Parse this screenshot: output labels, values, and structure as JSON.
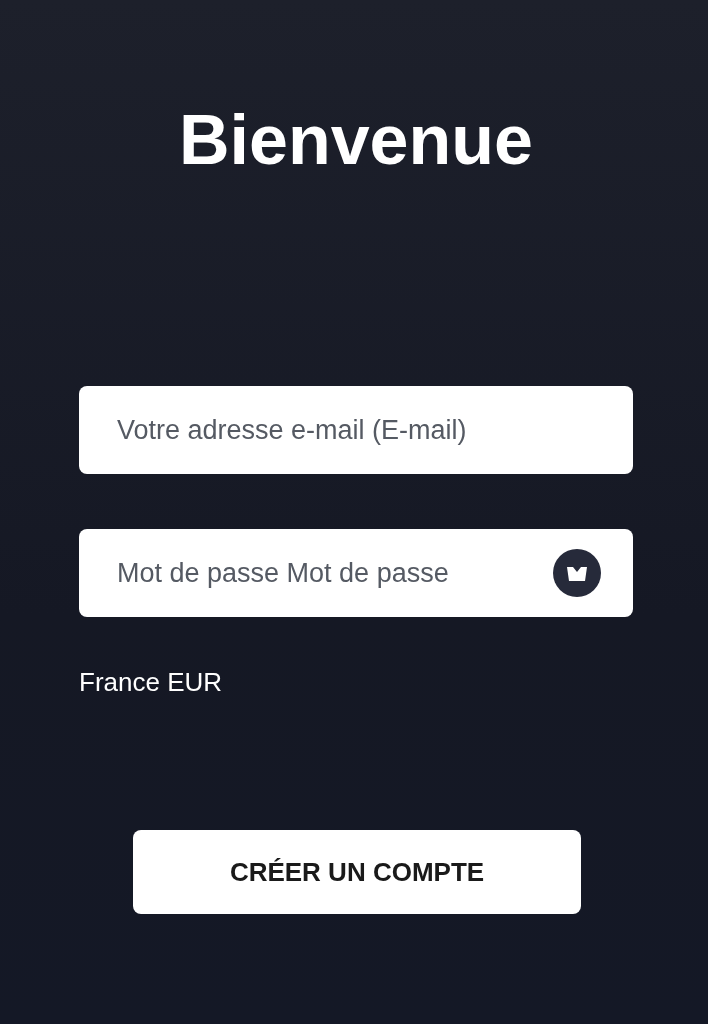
{
  "title": "Bienvenue",
  "email_field": {
    "placeholder": "Votre adresse e-mail (E-mail)"
  },
  "password_field": {
    "placeholder": "Mot de passe Mot de passe"
  },
  "region": "France EUR",
  "create_button": {
    "label": "CRÉER UN COMPTE"
  }
}
